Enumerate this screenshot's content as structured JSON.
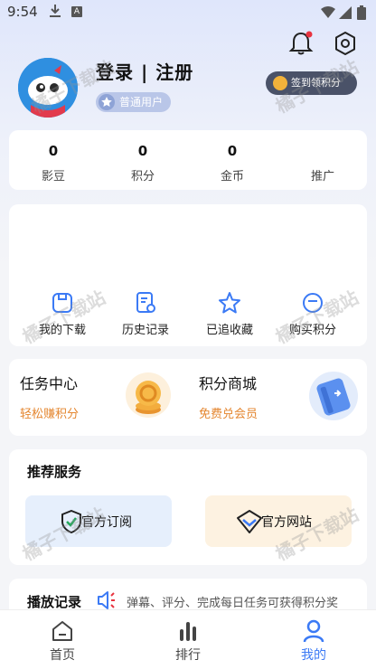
{
  "status_bar": {
    "time": "9:54",
    "a_icon": "A"
  },
  "header": {
    "login_label": "登录 | 注册",
    "user_level": "普通用户",
    "checkin_label": "签到领积分"
  },
  "stats": [
    {
      "value": "0",
      "label": "影豆"
    },
    {
      "value": "0",
      "label": "积分"
    },
    {
      "value": "0",
      "label": "金币"
    },
    {
      "value": "",
      "label": "推广"
    }
  ],
  "tools": [
    {
      "label": "我的下载",
      "icon": "download-box-icon"
    },
    {
      "label": "历史记录",
      "icon": "history-doc-icon"
    },
    {
      "label": "已追收藏",
      "icon": "star-icon"
    },
    {
      "label": "购买积分",
      "icon": "points-coin-icon"
    }
  ],
  "promos": [
    {
      "title": "任务中心",
      "subtitle": "轻松赚积分"
    },
    {
      "title": "积分商城",
      "subtitle": "免费兑会员"
    }
  ],
  "services": {
    "title": "推荐服务",
    "items": [
      {
        "label": "官方订阅",
        "icon": "shield-check-icon"
      },
      {
        "label": "官方网站",
        "icon": "diamond-chevron-icon"
      }
    ]
  },
  "history": {
    "title": "播放记录",
    "marquee": "弹幕、评分、完成每日任务可获得积分奖"
  },
  "bottom_nav": [
    {
      "label": "首页",
      "icon": "home-icon",
      "active": false
    },
    {
      "label": "排行",
      "icon": "ranking-bars-icon",
      "active": false
    },
    {
      "label": "我的",
      "icon": "profile-icon",
      "active": true
    }
  ],
  "watermark": "橘子下载站",
  "colors": {
    "accent": "#3b7af5",
    "promo_subtitle": "#e4862f",
    "subscribe_bg": "#e6effc",
    "website_bg": "#fdf2e1"
  }
}
